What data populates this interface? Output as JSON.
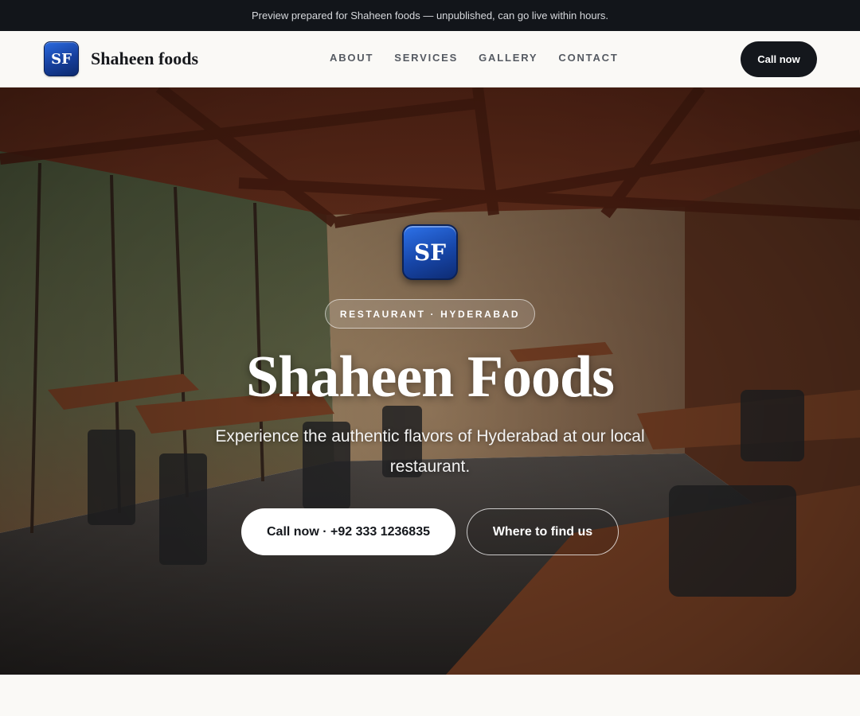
{
  "banner": {
    "text": "Preview prepared for Shaheen foods — unpublished, can go live within hours."
  },
  "header": {
    "logo_text": "SF",
    "brand_name": "Shaheen foods",
    "nav": [
      {
        "label": "ABOUT"
      },
      {
        "label": "SERVICES"
      },
      {
        "label": "GALLERY"
      },
      {
        "label": "CONTACT"
      }
    ],
    "cta_label": "Call now"
  },
  "hero": {
    "logo_text": "SF",
    "badge": "RESTAURANT · HYDERABAD",
    "title": "Shaheen Foods",
    "subtitle": "Experience the authentic flavors of Hyderabad at our local restaurant.",
    "primary_button": "Call now · +92 333 1236835",
    "secondary_button": "Where to find us",
    "background_image": "restaurant dining room with wooden tables, chairs and glass walls"
  },
  "colors": {
    "banner_bg": "#12151a",
    "header_bg": "#faf9f6",
    "cta_bg": "#14171c",
    "logo_blue": "#1746a8"
  }
}
